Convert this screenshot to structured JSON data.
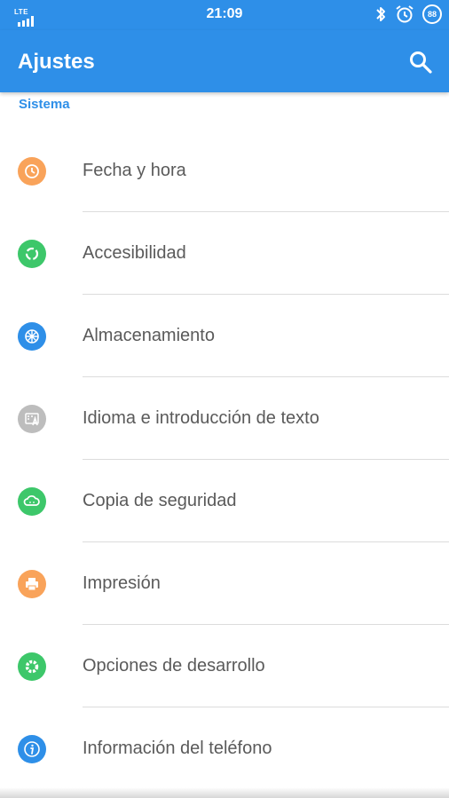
{
  "status_bar": {
    "network": "LTE",
    "time": "21:09",
    "battery": "88",
    "icons": [
      "signal-icon",
      "bluetooth-icon",
      "alarm-icon",
      "battery-icon"
    ]
  },
  "app_bar": {
    "title": "Ajustes",
    "icon": "search-icon"
  },
  "section": {
    "header": "Sistema"
  },
  "items": [
    {
      "label": "Fecha y hora",
      "icon": "clock-icon",
      "color": "#f9a35a"
    },
    {
      "label": "Accesibilidad",
      "icon": "accessibility-icon",
      "color": "#3dc76a"
    },
    {
      "label": "Almacenamiento",
      "icon": "storage-icon",
      "color": "#2e8fe8"
    },
    {
      "label": "Idioma e introducción de texto",
      "icon": "language-icon",
      "color": "#bdbdbd"
    },
    {
      "label": "Copia de seguridad",
      "icon": "backup-cloud-icon",
      "color": "#3dc76a"
    },
    {
      "label": "Impresión",
      "icon": "printer-icon",
      "color": "#f9a35a"
    },
    {
      "label": "Opciones de desarrollo",
      "icon": "developer-gear-icon",
      "color": "#3dc76a"
    },
    {
      "label": "Información del teléfono",
      "icon": "info-icon",
      "color": "#2e8fe8"
    }
  ],
  "colors": {
    "primary": "#2e8fe8",
    "text": "#5a5a5a",
    "divider": "#dcdcdc"
  }
}
